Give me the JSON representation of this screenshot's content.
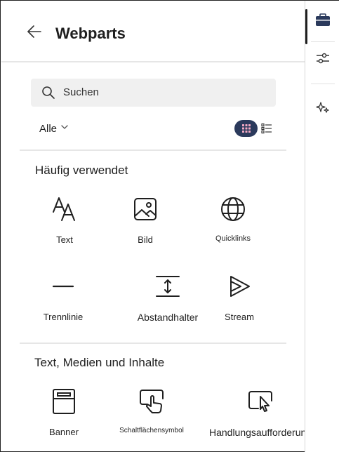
{
  "header": {
    "title": "Webparts"
  },
  "search": {
    "placeholder": "Suchen"
  },
  "filter": {
    "label": "Alle"
  },
  "sections": [
    {
      "title": "Häufig verwendet",
      "items": [
        {
          "label": "Text",
          "icon": "text-icon"
        },
        {
          "label": "Bild",
          "icon": "image-icon"
        },
        {
          "label": "Quicklinks",
          "icon": "globe-icon"
        },
        {
          "label": "Trennlinie",
          "icon": "divider-icon"
        },
        {
          "label": "Abstandhalter",
          "icon": "spacer-icon"
        },
        {
          "label": "Stream",
          "icon": "stream-icon"
        }
      ]
    },
    {
      "title": "Text, Medien und Inhalte",
      "items": [
        {
          "label": "Banner",
          "icon": "banner-icon"
        },
        {
          "label": "Schaltflächensymbol",
          "icon": "button-icon"
        },
        {
          "label": "Handlungsaufforderung",
          "icon": "call-to-action-icon"
        }
      ]
    }
  ],
  "rail": {
    "items": [
      {
        "icon": "toolbox-icon",
        "active": true
      },
      {
        "icon": "settings-sliders-icon",
        "active": false
      },
      {
        "icon": "sparkle-icon",
        "active": false
      }
    ]
  },
  "colors": {
    "accent": "#2b3a5c",
    "text": "#1f1f1f",
    "search_bg": "#f0f0f0"
  }
}
